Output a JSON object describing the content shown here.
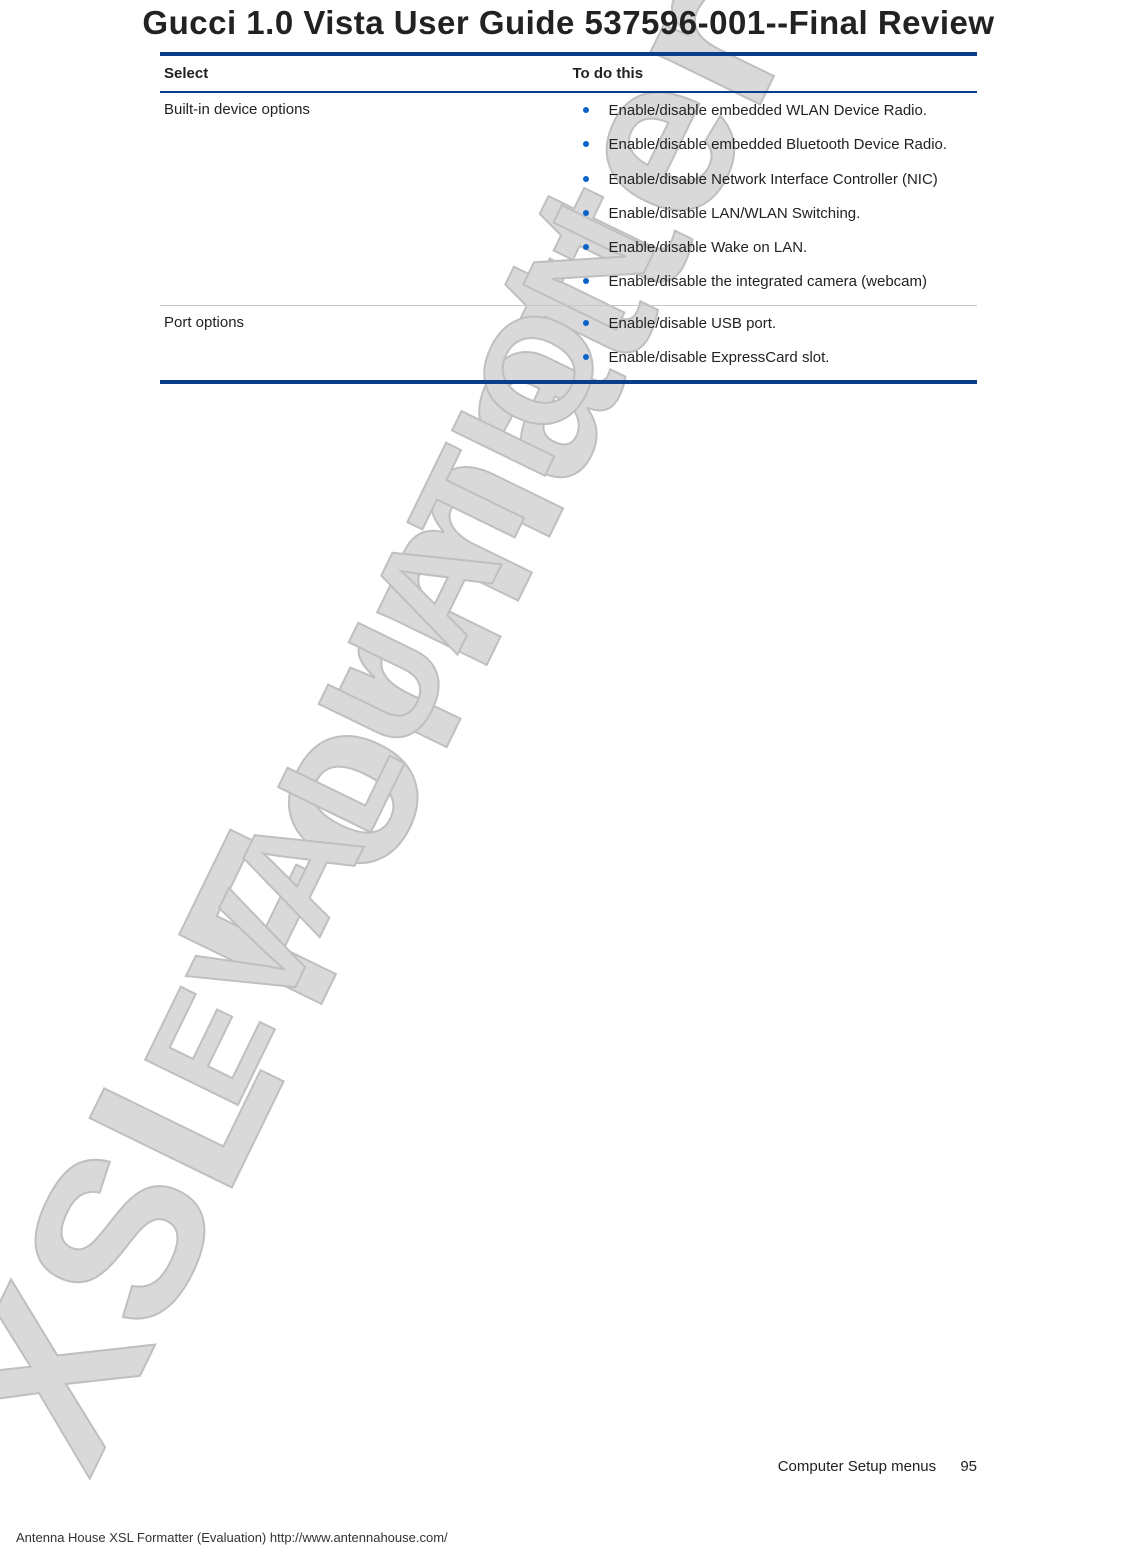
{
  "title": "Gucci 1.0 Vista User Guide 537596-001--Final Review",
  "watermark": {
    "line1": "XSL Formatter",
    "line2": "EVALUATION"
  },
  "table": {
    "headers": {
      "select": "Select",
      "todo": "To do this"
    },
    "rows": [
      {
        "select": "Built-in device options",
        "items": [
          "Enable/disable embedded WLAN Device Radio.",
          "Enable/disable embedded Bluetooth Device Radio.",
          "Enable/disable Network Interface Controller (NIC)",
          "Enable/disable LAN/WLAN Switching.",
          "Enable/disable Wake on LAN.",
          "Enable/disable the integrated camera (webcam)"
        ]
      },
      {
        "select": "Port options",
        "items": [
          "Enable/disable USB port.",
          "Enable/disable ExpressCard slot."
        ]
      }
    ]
  },
  "footer": {
    "section": "Computer Setup menus",
    "page": "95",
    "imprint": "Antenna House XSL Formatter (Evaluation)  http://www.antennahouse.com/"
  }
}
